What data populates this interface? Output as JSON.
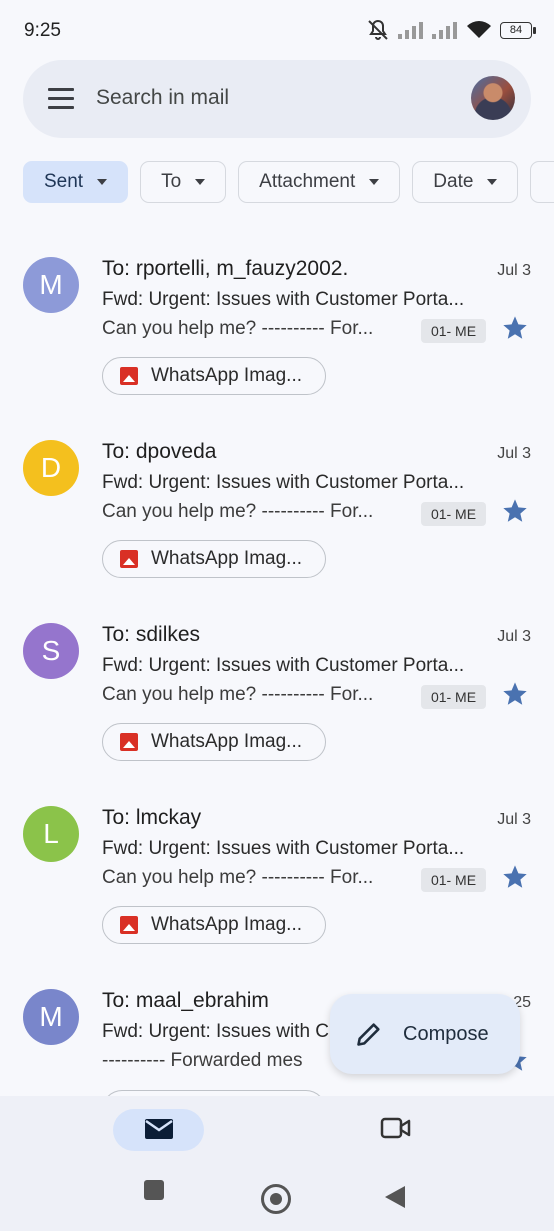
{
  "status_bar": {
    "time": "9:25",
    "battery": "84"
  },
  "search": {
    "placeholder": "Search in mail"
  },
  "filters": [
    {
      "label": "Sent",
      "active": true
    },
    {
      "label": "To"
    },
    {
      "label": "Attachment"
    },
    {
      "label": "Date"
    }
  ],
  "emails": [
    {
      "initial": "M",
      "avatar_color": "#8d9ad8",
      "to": "To: rportelli, m_fauzy2002.",
      "date": "Jul 3",
      "subject": "Fwd: Urgent: Issues with Customer Porta...",
      "snippet": "Can you help me? ---------- For...",
      "label": "01- ME",
      "attachment": "WhatsApp Imag..."
    },
    {
      "initial": "D",
      "avatar_color": "#f4c01e",
      "to": "To: dpoveda",
      "date": "Jul 3",
      "subject": "Fwd: Urgent: Issues with Customer Porta...",
      "snippet": "Can you help me? ---------- For...",
      "label": "01- ME",
      "attachment": "WhatsApp Imag..."
    },
    {
      "initial": "S",
      "avatar_color": "#9575cd",
      "to": "To: sdilkes",
      "date": "Jul 3",
      "subject": "Fwd: Urgent: Issues with Customer Porta...",
      "snippet": "Can you help me? ---------- For...",
      "label": "01- ME",
      "attachment": "WhatsApp Imag..."
    },
    {
      "initial": "L",
      "avatar_color": "#8bc34a",
      "to": "To: lmckay",
      "date": "Jul 3",
      "subject": "Fwd: Urgent: Issues with Customer Porta...",
      "snippet": "Can you help me? ---------- For...",
      "label": "01- ME",
      "attachment": "WhatsApp Imag..."
    },
    {
      "initial": "M",
      "avatar_color": "#7986cb",
      "to": "To: maal_ebrahim",
      "date": "25",
      "subject": "Fwd: Urgent: Issues with C",
      "snippet": "---------- Forwarded mes",
      "label": "",
      "attachment": ""
    }
  ],
  "compose": {
    "label": "Compose"
  },
  "colors": {
    "star": "#4a72b0",
    "accent": "#d6e3fa"
  }
}
